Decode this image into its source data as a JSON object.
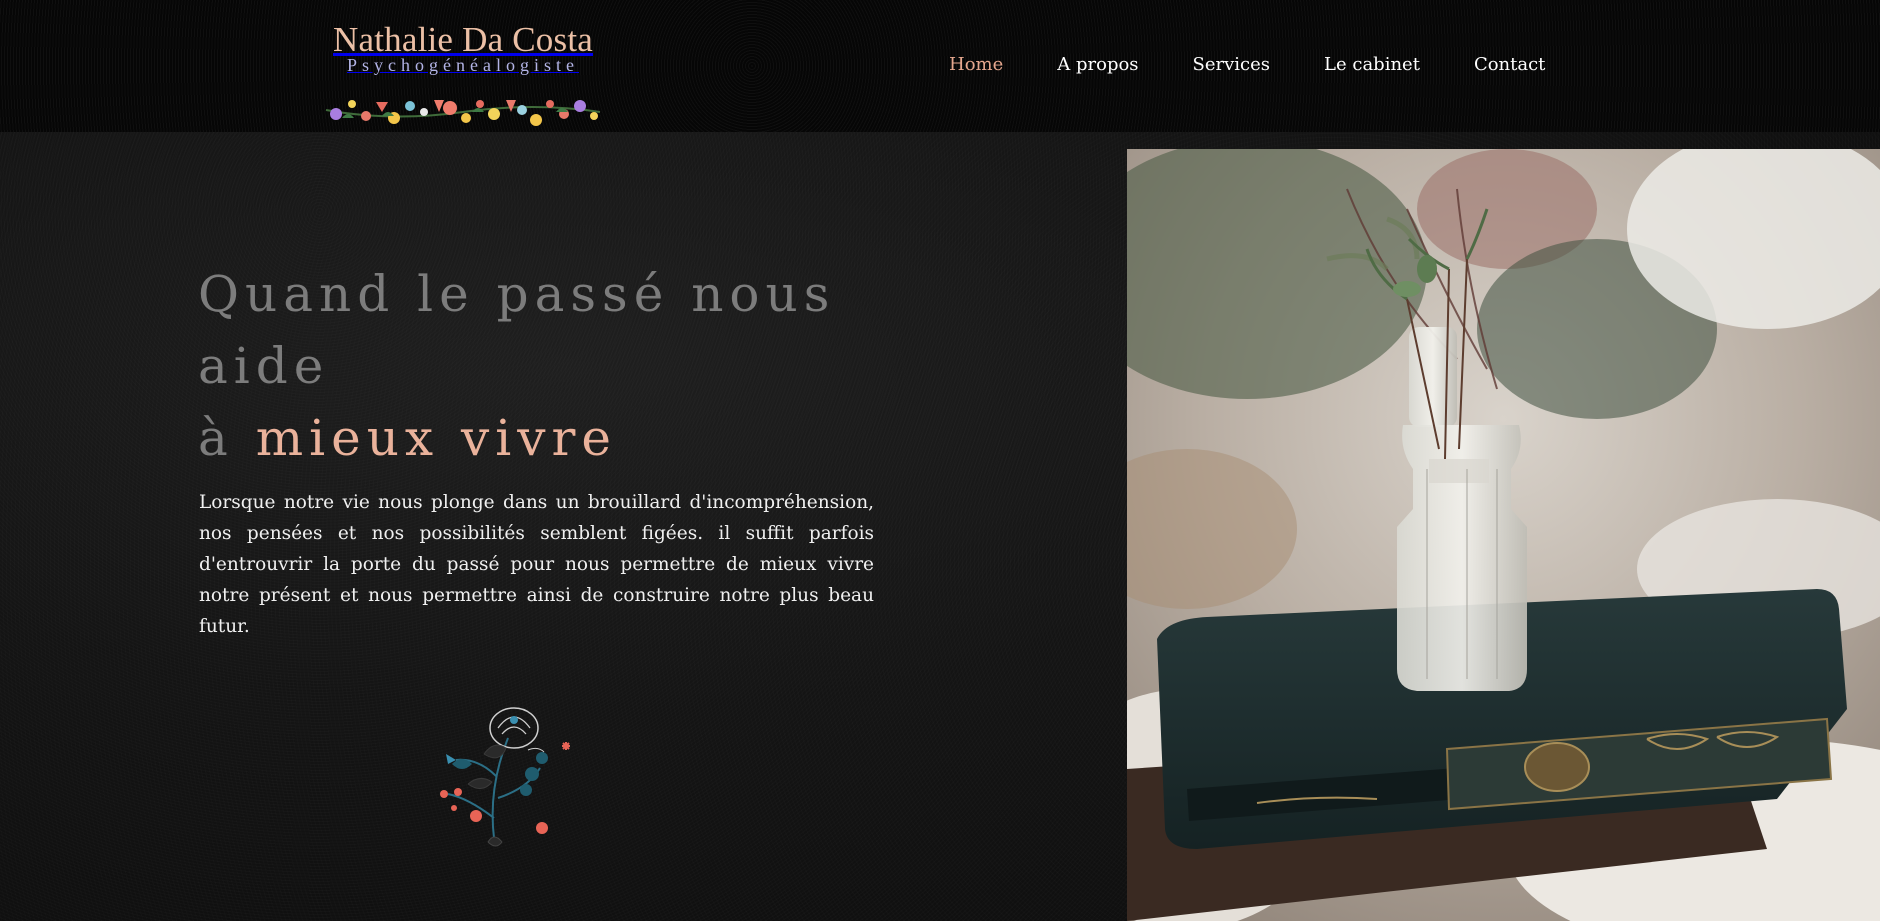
{
  "header": {
    "logo": {
      "name": "Nathalie Da Costa",
      "subtitle": "Psychogénéalogiste"
    },
    "nav": [
      {
        "label": "Home",
        "active": true
      },
      {
        "label": "A propos",
        "active": false
      },
      {
        "label": "Services",
        "active": false
      },
      {
        "label": "Le cabinet",
        "active": false
      },
      {
        "label": "Contact",
        "active": false
      }
    ]
  },
  "hero": {
    "title_line1": "Quand le passé nous aide",
    "title_line2_prefix": "à ",
    "title_line2_accent": "mieux vivre",
    "paragraph": "Lorsque notre vie nous  plonge dans un brouillard  d'incompréhension, nos pensées et nos possibilités semblent figées. il suffit parfois d'entrouvrir la porte du passé pour nous permettre de mieux vivre notre présent et nous permettre ainsi de construire notre plus beau futur."
  },
  "icons": {
    "logo_decoration": "floral-garland-icon",
    "hero_decoration": "flower-bouquet-icon"
  },
  "photo": {
    "subject": "glass-bottle-on-books-photo"
  },
  "colors": {
    "accent": "#eab29b",
    "nav_active": "#e6a88f",
    "logo_subtitle": "#b3b4e6",
    "title_muted": "#7c7c7c",
    "background": "#111111"
  }
}
